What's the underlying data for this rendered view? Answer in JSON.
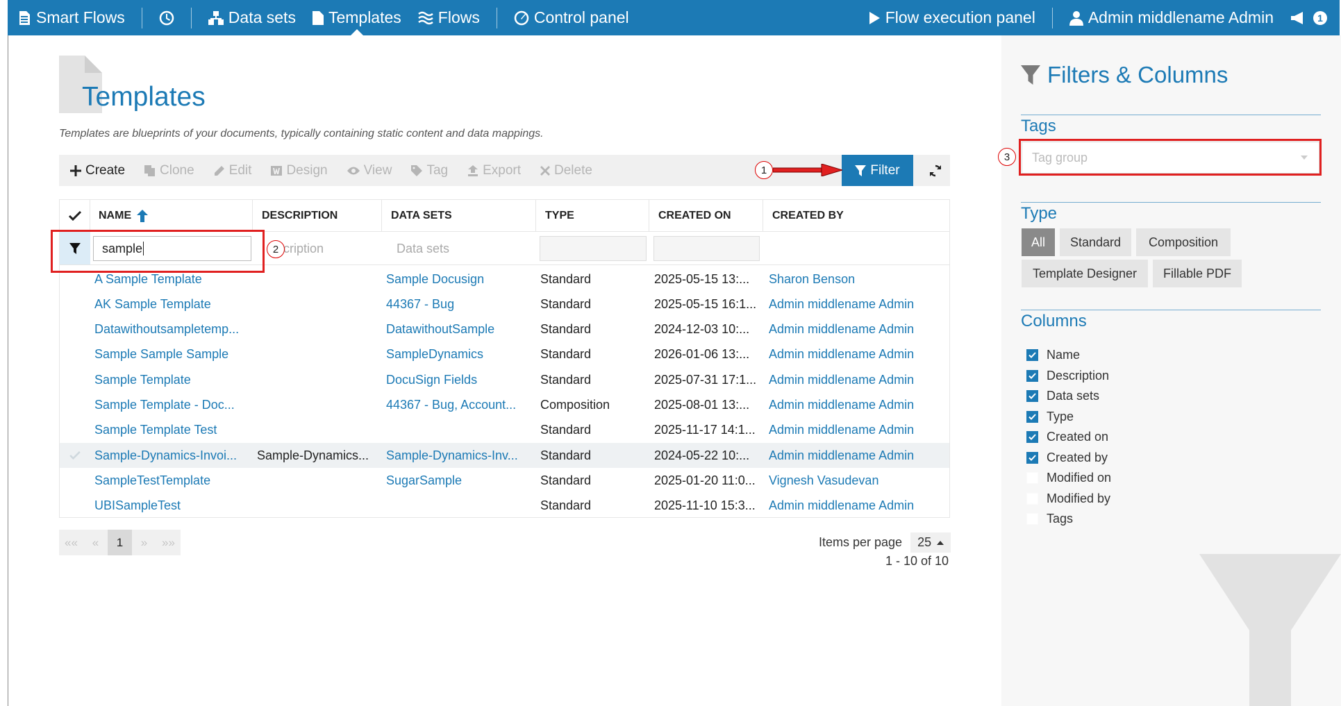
{
  "nav": {
    "brand": "Smart Flows",
    "datasets": "Data sets",
    "templates": "Templates",
    "flows": "Flows",
    "control_panel": "Control panel",
    "flow_execution": "Flow execution panel",
    "user": "Admin middlename Admin",
    "notifications": "1"
  },
  "page": {
    "title": "Templates",
    "description": "Templates are blueprints of your documents, typically containing static content and data mappings."
  },
  "toolbar": {
    "create": "Create",
    "clone": "Clone",
    "edit": "Edit",
    "design": "Design",
    "view": "View",
    "tag": "Tag",
    "export": "Export",
    "delete": "Delete",
    "filter": "Filter"
  },
  "annotations": {
    "one": "1",
    "two": "2",
    "three": "3"
  },
  "table": {
    "headers": {
      "name": "NAME",
      "description": "DESCRIPTION",
      "datasets": "DATA SETS",
      "type": "TYPE",
      "created_on": "CREATED ON",
      "created_by": "CREATED BY"
    },
    "filters": {
      "name_value": "sample",
      "description_placeholder": "cription",
      "datasets_placeholder": "Data sets"
    },
    "rows": [
      {
        "name": "A Sample Template",
        "description": "",
        "datasets": "Sample Docusign",
        "type": "Standard",
        "created_on": "2025-05-15 13:...",
        "created_by": "Sharon Benson"
      },
      {
        "name": "AK Sample Template",
        "description": "",
        "datasets": "44367 - Bug",
        "type": "Standard",
        "created_on": "2025-05-15 16:1...",
        "created_by": "Admin middlename Admin"
      },
      {
        "name": "Datawithoutsampletemp...",
        "description": "",
        "datasets": "DatawithoutSample",
        "type": "Standard",
        "created_on": "2024-12-03 10:...",
        "created_by": "Admin middlename Admin"
      },
      {
        "name": "Sample Sample Sample",
        "description": "",
        "datasets": "SampleDynamics",
        "type": "Standard",
        "created_on": "2026-01-06 13:...",
        "created_by": "Admin middlename Admin"
      },
      {
        "name": "Sample Template",
        "description": "",
        "datasets": "DocuSign Fields",
        "type": "Standard",
        "created_on": "2025-07-31 17:1...",
        "created_by": "Admin middlename Admin"
      },
      {
        "name": "Sample Template - Doc...",
        "description": "",
        "datasets": "44367 - Bug, Account...",
        "type": "Composition",
        "created_on": "2025-08-01 13:...",
        "created_by": "Admin middlename Admin"
      },
      {
        "name": "Sample Template Test",
        "description": "",
        "datasets": "",
        "type": "Standard",
        "created_on": "2025-11-17 14:1...",
        "created_by": "Admin middlename Admin"
      },
      {
        "name": "Sample-Dynamics-Invoi...",
        "description": "Sample-Dynamics...",
        "datasets": "Sample-Dynamics-Inv...",
        "type": "Standard",
        "created_on": "2024-05-22 10:...",
        "created_by": "Admin middlename Admin"
      },
      {
        "name": "SampleTestTemplate",
        "description": "",
        "datasets": "SugarSample",
        "type": "Standard",
        "created_on": "2025-01-20 11:0...",
        "created_by": "Vignesh Vasudevan"
      },
      {
        "name": "UBISampleTest",
        "description": "",
        "datasets": "",
        "type": "Standard",
        "created_on": "2025-11-10 15:3...",
        "created_by": "Admin middlename Admin"
      }
    ]
  },
  "pager": {
    "first": "««",
    "prev": "«",
    "current": "1",
    "next": "»",
    "last": "»»",
    "items_per_page_label": "Items per page",
    "items_per_page": "25",
    "count": "1 - 10 of 10"
  },
  "side": {
    "title": "Filters & Columns",
    "tags_label": "Tags",
    "tags_placeholder": "Tag group",
    "type_label": "Type",
    "types": [
      "All",
      "Standard",
      "Composition",
      "Template Designer",
      "Fillable PDF"
    ],
    "columns_label": "Columns",
    "columns": [
      {
        "label": "Name",
        "checked": true
      },
      {
        "label": "Description",
        "checked": true
      },
      {
        "label": "Data sets",
        "checked": true
      },
      {
        "label": "Type",
        "checked": true
      },
      {
        "label": "Created on",
        "checked": true
      },
      {
        "label": "Created by",
        "checked": true
      },
      {
        "label": "Modified on",
        "checked": false
      },
      {
        "label": "Modified by",
        "checked": false
      },
      {
        "label": "Tags",
        "checked": false
      }
    ]
  },
  "colors": {
    "primary": "#1c7ab5",
    "annotation": "#e02020"
  }
}
